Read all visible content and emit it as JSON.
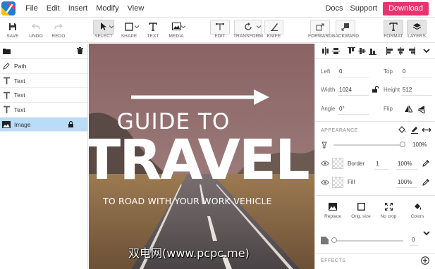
{
  "menubar": {
    "items": [
      "File",
      "Edit",
      "Insert",
      "Modify",
      "View"
    ],
    "docs": "Docs",
    "support": "Support",
    "download": "Download"
  },
  "toolbar": {
    "save": "SAVE",
    "undo": "UNDO",
    "redo": "REDO",
    "select": "SELECT",
    "shape": "SHAPE",
    "text": "TEXT",
    "media": "MEDIA",
    "edit": "EDIT",
    "transform": "TRANSFORM",
    "knife": "KNIFE",
    "forward": "FORWARD",
    "backward": "BACKWARD",
    "format": "FORMAT",
    "layers": "LAYERS"
  },
  "layers": [
    {
      "label": "Path",
      "icon": "pen-icon"
    },
    {
      "label": "Text",
      "icon": "text-icon"
    },
    {
      "label": "Text",
      "icon": "text-icon"
    },
    {
      "label": "Text",
      "icon": "text-icon"
    },
    {
      "label": "Image",
      "icon": "image-icon",
      "selected": true,
      "locked": true
    }
  ],
  "canvas": {
    "heading": "GUIDE TO",
    "title": "TRAVEL",
    "subtitle": "TO ROAD WITH YOUR WORK VEHICLE",
    "watermark": "双电网(www.pcpc.me)"
  },
  "properties": {
    "left_label": "Left",
    "left_value": "0",
    "top_label": "Top",
    "top_value": "0",
    "width_label": "Width",
    "width_value": "1024",
    "height_label": "Height",
    "height_value": "512",
    "angle_label": "Angle",
    "angle_value": "0°",
    "flip_label": "Flip"
  },
  "appearance": {
    "title": "APPEARANCE",
    "opacity_value": "100%",
    "opacity": 1.0,
    "border_label": "Border",
    "border_width": "1",
    "border_opacity": "100%",
    "fill_label": "Fill",
    "fill_opacity": "100%"
  },
  "image_actions": {
    "replace": "Replace",
    "orig_size": "Orig. size",
    "no_crop": "No crop",
    "colors": "Colors"
  },
  "filter": {
    "value": "0",
    "level": 0
  },
  "effects": {
    "title": "EFFECTS"
  },
  "colors": {
    "accent": "#e8336d",
    "selection": "#b9dcf9"
  }
}
